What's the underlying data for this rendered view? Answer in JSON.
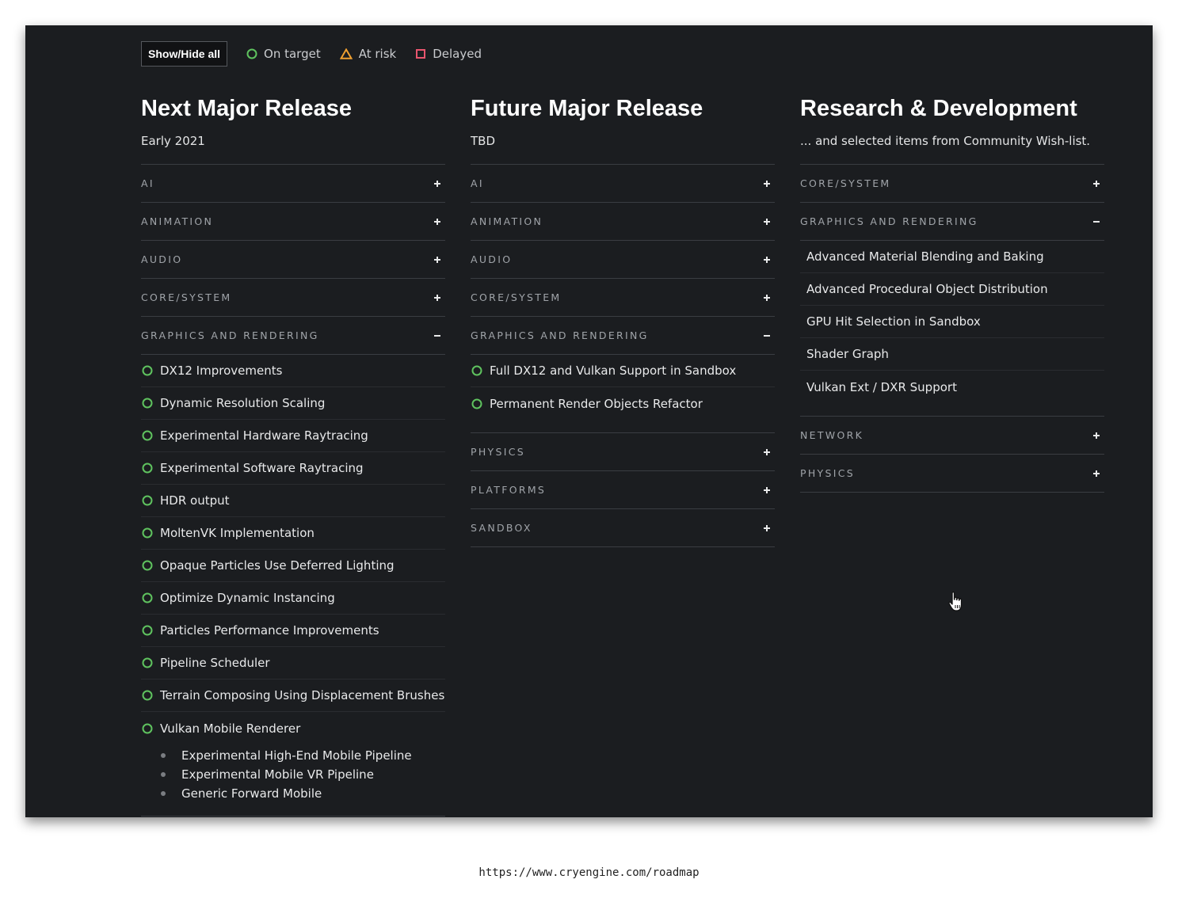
{
  "toolbar": {
    "show_hide_label": "Show/Hide all",
    "legend": [
      {
        "label": "On target",
        "icon": "circle-icon",
        "color": "#5fc35f"
      },
      {
        "label": "At risk",
        "icon": "triangle-icon",
        "color": "#f0a030"
      },
      {
        "label": "Delayed",
        "icon": "square-icon",
        "color": "#e8556e"
      }
    ]
  },
  "columns": [
    {
      "title": "Next Major Release",
      "subtitle": "Early 2021",
      "categories": [
        {
          "label": "AI",
          "state": "collapsed"
        },
        {
          "label": "ANIMATION",
          "state": "collapsed"
        },
        {
          "label": "AUDIO",
          "state": "collapsed"
        },
        {
          "label": "CORE/SYSTEM",
          "state": "collapsed"
        },
        {
          "label": "GRAPHICS AND RENDERING",
          "state": "expanded",
          "items": [
            {
              "name": "DX12 Improvements",
              "status": "on-target"
            },
            {
              "name": "Dynamic Resolution Scaling",
              "status": "on-target"
            },
            {
              "name": "Experimental Hardware Raytracing",
              "status": "on-target"
            },
            {
              "name": "Experimental Software Raytracing",
              "status": "on-target"
            },
            {
              "name": "HDR output",
              "status": "on-target"
            },
            {
              "name": "MoltenVK Implementation",
              "status": "on-target"
            },
            {
              "name": "Opaque Particles Use Deferred Lighting",
              "status": "on-target"
            },
            {
              "name": "Optimize Dynamic Instancing",
              "status": "on-target"
            },
            {
              "name": "Particles Performance Improvements",
              "status": "on-target"
            },
            {
              "name": "Pipeline Scheduler",
              "status": "on-target"
            },
            {
              "name": "Terrain Composing Using Displacement Brushes",
              "status": "on-target"
            },
            {
              "name": "Vulkan Mobile Renderer",
              "status": "on-target",
              "subitems": [
                "Experimental High-End Mobile Pipeline",
                "Experimental Mobile VR Pipeline",
                "Generic Forward Mobile"
              ]
            }
          ]
        }
      ]
    },
    {
      "title": "Future Major Release",
      "subtitle": "TBD",
      "categories": [
        {
          "label": "AI",
          "state": "collapsed"
        },
        {
          "label": "ANIMATION",
          "state": "collapsed"
        },
        {
          "label": "AUDIO",
          "state": "collapsed"
        },
        {
          "label": "CORE/SYSTEM",
          "state": "collapsed"
        },
        {
          "label": "GRAPHICS AND RENDERING",
          "state": "expanded",
          "items": [
            {
              "name": "Full DX12 and Vulkan Support in Sandbox",
              "status": "on-target"
            },
            {
              "name": "Permanent Render Objects Refactor",
              "status": "on-target"
            }
          ]
        },
        {
          "label": "PHYSICS",
          "state": "collapsed"
        },
        {
          "label": "PLATFORMS",
          "state": "collapsed"
        },
        {
          "label": "SANDBOX",
          "state": "collapsed"
        }
      ]
    },
    {
      "title": "Research & Development",
      "subtitle": "... and selected items from Community Wish-list.",
      "categories": [
        {
          "label": "CORE/SYSTEM",
          "state": "collapsed"
        },
        {
          "label": "GRAPHICS AND RENDERING",
          "state": "expanded",
          "items": [
            {
              "name": "Advanced Material Blending and Baking",
              "status": "none"
            },
            {
              "name": "Advanced Procedural Object Distribution",
              "status": "none"
            },
            {
              "name": "GPU Hit Selection in Sandbox",
              "status": "none"
            },
            {
              "name": "Shader Graph",
              "status": "none"
            },
            {
              "name": "Vulkan Ext / DXR Support",
              "status": "none"
            }
          ]
        },
        {
          "label": "NETWORK",
          "state": "collapsed"
        },
        {
          "label": "PHYSICS",
          "state": "collapsed"
        }
      ]
    }
  ],
  "footer": {
    "url": "https://www.cryengine.com/roadmap"
  }
}
